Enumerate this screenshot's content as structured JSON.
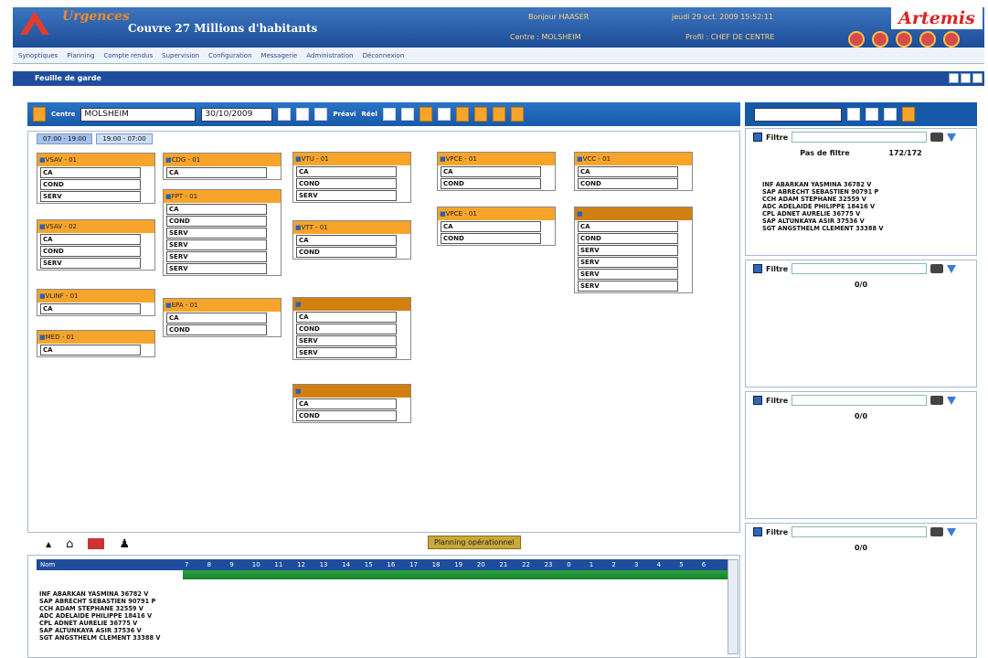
{
  "app": {
    "logo_letter": "A",
    "name": "Urgences",
    "subtitle": "Couvre 27 Millions d'habitants",
    "greeting": "Bonjour HAASER",
    "center": "Centre : MOLSHEIM",
    "datetime": "jeudi 29 oct. 2009 15:52:11",
    "profile": "Profil : CHEF DE CENTRE",
    "brand": "Artemis"
  },
  "menu": [
    "Synoptiques",
    "Planning",
    "Compte rendus",
    "Supervision",
    "Configuration",
    "Messagerie",
    "Administration",
    "Déconnexion"
  ],
  "window": {
    "title": "Feuille de garde"
  },
  "toolbar": {
    "center_label": "Centre",
    "center_value": "MOLSHEIM",
    "date_value": "30/10/2009",
    "prev_label": "Préavi",
    "real_label": "Réel"
  },
  "tabs": [
    "07:00 - 19:00",
    "19:00 - 07:00"
  ],
  "vehicles": [
    {
      "id": "v1",
      "title": "VSAV - 01",
      "rows": [
        "CA",
        "COND",
        "SERV"
      ]
    },
    {
      "id": "v2",
      "title": "VSAV - 02",
      "rows": [
        "CA",
        "COND",
        "SERV"
      ]
    },
    {
      "id": "v3",
      "title": "VLINF - 01",
      "rows": [
        "CA"
      ]
    },
    {
      "id": "v4",
      "title": "MED - 01",
      "rows": [
        "CA"
      ]
    },
    {
      "id": "v5",
      "title": "CDG - 01",
      "rows": [
        "CA"
      ]
    },
    {
      "id": "v6",
      "title": "FPT - 01",
      "rows": [
        "CA",
        "COND",
        "SERV",
        "SERV",
        "SERV",
        "SERV"
      ]
    },
    {
      "id": "v7",
      "title": "EPA - 01",
      "rows": [
        "CA",
        "COND"
      ]
    },
    {
      "id": "v8",
      "title": "VTU - 01",
      "rows": [
        "CA",
        "COND",
        "SERV"
      ]
    },
    {
      "id": "v9",
      "title": "VTT - 01",
      "rows": [
        "CA",
        "COND"
      ]
    },
    {
      "id": "v10",
      "title": "",
      "rows": [
        "CA",
        "COND",
        "SERV",
        "SERV"
      ]
    },
    {
      "id": "v11",
      "title": "",
      "rows": [
        "CA",
        "COND"
      ]
    },
    {
      "id": "v12",
      "title": "VPCE - 01",
      "rows": [
        "CA",
        "COND"
      ]
    },
    {
      "id": "v13",
      "title": "VPCE - 01",
      "rows": [
        "CA",
        "COND"
      ]
    },
    {
      "id": "v14",
      "title": "VCC - 01",
      "rows": [
        "CA",
        "COND"
      ]
    },
    {
      "id": "v15",
      "title": "",
      "rows": [
        "CA",
        "COND",
        "SERV",
        "SERV",
        "SERV",
        "SERV"
      ]
    }
  ],
  "planning_label": "Planning opérationnel",
  "timeline": {
    "header": "Nom",
    "hours": [
      "7",
      "8",
      "9",
      "10",
      "11",
      "12",
      "13",
      "14",
      "15",
      "16",
      "17",
      "18",
      "19",
      "20",
      "21",
      "22",
      "23",
      "0",
      "1",
      "2",
      "3",
      "4",
      "5",
      "6"
    ]
  },
  "people": [
    "INF ABARKAN YASMINA 36782 V",
    "SAP ABRECHT SEBASTIEN 90791 P",
    "CCH ADAM STEPHANE 32559 V",
    "ADC ADELAIDE PHILIPPE 18416 V",
    "CPL ADNET AURELIE 36775 V",
    "SAP ALTUNKAYA ASIR 37536 V",
    "SGT ANGSTHELM CLEMENT 33388 V"
  ],
  "filter_panels": [
    {
      "label": "Filtre",
      "sub": "Pas de filtre",
      "count": "172/172"
    },
    {
      "label": "Filtre",
      "sub": "",
      "count": "0/0"
    },
    {
      "label": "Filtre",
      "sub": "",
      "count": "0/0"
    },
    {
      "label": "Filtre",
      "sub": "",
      "count": "0/0"
    }
  ]
}
